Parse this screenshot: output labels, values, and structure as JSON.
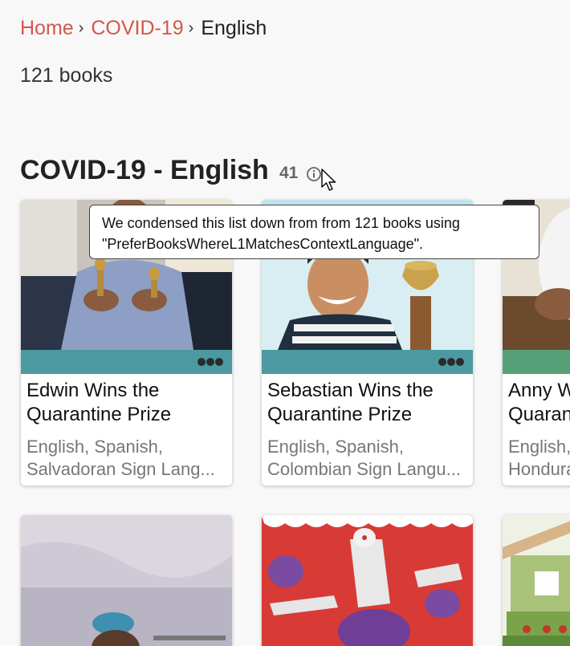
{
  "breadcrumb": {
    "home": "Home",
    "collection": "COVID-19",
    "current": "English",
    "separator": "›"
  },
  "book_count_text": "121 books",
  "section": {
    "title": "COVID-19 - English",
    "count": "41"
  },
  "tooltip": {
    "line1": "We condensed this list down from from 121 books using",
    "line2": "\"PreferBooksWhereL1MatchesContextLanguage\"."
  },
  "books": [
    {
      "title_line1": "Edwin Wins the",
      "title_line2": "Quarantine Prize",
      "langs_line1": "English, Spanish,",
      "langs_line2": "Salvadoran Sign Lang..."
    },
    {
      "title_line1": "Sebastian Wins the",
      "title_line2": "Quarantine Prize",
      "langs_line1": "English, Spanish,",
      "langs_line2": "Colombian Sign Langu..."
    },
    {
      "title_line1": "Anny W",
      "title_line2": "Quaran",
      "langs_line1": "English,",
      "langs_line2": "Hondura"
    }
  ],
  "colors": {
    "link": "#d65649",
    "menu_bar_teal": "#4b9aa1",
    "menu_bar_green": "#57a077",
    "background": "#f8f8f8"
  }
}
